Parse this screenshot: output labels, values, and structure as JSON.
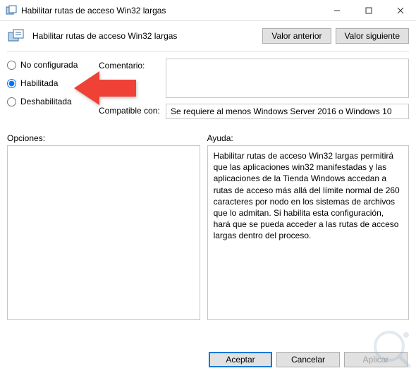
{
  "window": {
    "title": "Habilitar rutas de acceso Win32 largas"
  },
  "header": {
    "policy_title": "Habilitar rutas de acceso Win32 largas",
    "prev_btn": "Valor anterior",
    "next_btn": "Valor siguiente"
  },
  "radios": {
    "not_configured": "No configurada",
    "enabled": "Habilitada",
    "disabled": "Deshabilitada",
    "selected": "enabled"
  },
  "fields": {
    "comment_label": "Comentario:",
    "comment_value": "",
    "compat_label": "Compatible con:",
    "compat_value": "Se requiere al menos Windows Server 2016 o Windows 10"
  },
  "panels": {
    "options_label": "Opciones:",
    "help_label": "Ayuda:",
    "options_text": "",
    "help_text": "Habilitar rutas de acceso Win32 largas permitirá que las aplicaciones win32 manifestadas y las aplicaciones de la Tienda Windows accedan a rutas de acceso más allá del límite normal de 260 caracteres por nodo en los sistemas de archivos que lo admitan. Si habilita esta configuración, hará que se pueda acceder a las rutas de acceso largas dentro del proceso."
  },
  "footer": {
    "ok": "Aceptar",
    "cancel": "Cancelar",
    "apply": "Aplicar"
  }
}
